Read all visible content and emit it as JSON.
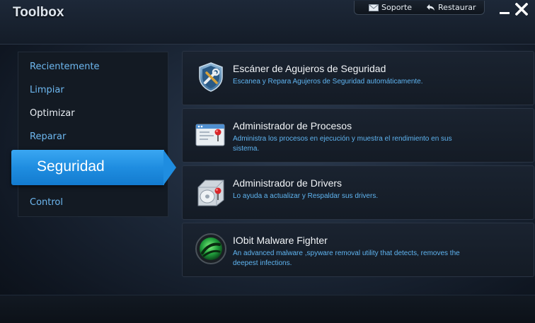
{
  "window": {
    "title": "Toolbox"
  },
  "topbar": {
    "support_label": "Soporte",
    "restore_label": "Restaurar"
  },
  "sidebar": {
    "items": [
      {
        "label": "Recientemente"
      },
      {
        "label": "Limpiar"
      },
      {
        "label": "Optimizar"
      },
      {
        "label": "Reparar"
      },
      {
        "label": "Seguridad",
        "active": true
      },
      {
        "label": "Control"
      }
    ]
  },
  "tools": [
    {
      "title": "Escáner de Agujeros de Seguridad",
      "description": "Escanea y Repara Agujeros de Seguridad automáticamente.",
      "icon": "shield-tools-icon"
    },
    {
      "title": "Administrador de Procesos",
      "description": "Administra los procesos en ejecución y muestra el rendimiento en sus sistema.",
      "icon": "process-window-icon"
    },
    {
      "title": "Administrador de Drivers",
      "description": "Lo ayuda a actualizar y Respaldar sus drivers.",
      "icon": "hard-drive-icon"
    },
    {
      "title": "IObit Malware Fighter",
      "description": "An advanced malware ,spyware removal utility that detects, removes the deepest infections.",
      "icon": "malware-fighter-icon"
    }
  ],
  "colors": {
    "accent": "#1f8de0",
    "link_blue": "#6db7ef",
    "desc_blue": "#5fb4f0"
  }
}
